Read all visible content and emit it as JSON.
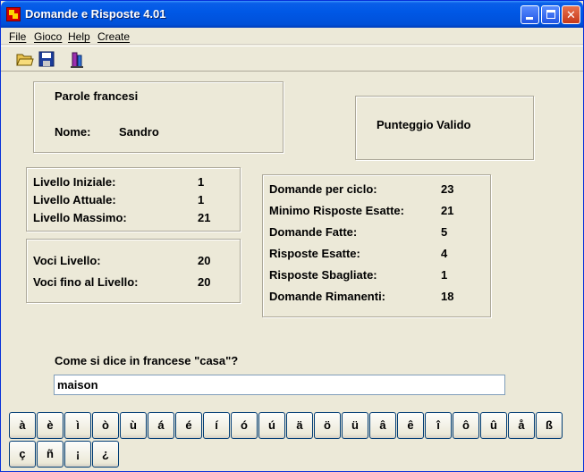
{
  "window": {
    "title": "Domande e Risposte 4.01"
  },
  "menu": [
    "File",
    "Gioco",
    "Help",
    "Create"
  ],
  "toolbar": {
    "icons": [
      "open-folder-icon",
      "save-disk-icon",
      "tool-icon"
    ]
  },
  "header": {
    "subject": "Parole francesi",
    "name_label": "Nome:",
    "name_value": "Sandro",
    "score_status": "Punteggio Valido"
  },
  "levels": {
    "rows": [
      {
        "label": "Livello Iniziale:",
        "value": "1"
      },
      {
        "label": "Livello Attuale:",
        "value": "1"
      },
      {
        "label": "Livello Massimo:",
        "value": "21"
      }
    ]
  },
  "entries": {
    "rows": [
      {
        "label": "Voci Livello:",
        "value": "20"
      },
      {
        "label": "Voci fino al Livello:",
        "value": "20"
      }
    ]
  },
  "stats": {
    "rows": [
      {
        "label": "Domande per ciclo:",
        "value": "23"
      },
      {
        "label": "Minimo Risposte Esatte:",
        "value": "21"
      },
      {
        "label": "Domande Fatte:",
        "value": "5"
      },
      {
        "label": "Risposte Esatte:",
        "value": "4"
      },
      {
        "label": "Risposte Sbagliate:",
        "value": "1"
      },
      {
        "label": "Domande Rimanenti:",
        "value": "18"
      }
    ]
  },
  "question": {
    "text": "Come si dice in francese \"casa\"?",
    "answer": "maison"
  },
  "chars": [
    "à",
    "è",
    "ì",
    "ò",
    "ù",
    "á",
    "é",
    "í",
    "ó",
    "ú",
    "ä",
    "ö",
    "ü",
    "â",
    "ê",
    "î",
    "ô",
    "û",
    "å",
    "ß",
    "ç",
    "ñ",
    "¡",
    "¿"
  ],
  "colors": {
    "title_bar": "#0058e6",
    "window_bg": "#ece9d8",
    "close_button": "#c6381a"
  }
}
